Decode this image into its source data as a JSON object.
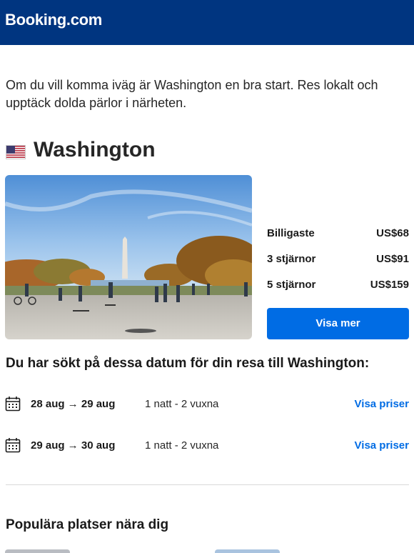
{
  "header": {
    "logo": "Booking.com",
    "bg": "#003580"
  },
  "intro_text": "Om du vill komma iväg är Washington en bra start. Res lokalt och upptäck dolda pärlor i närheten.",
  "destination": {
    "name": "Washington",
    "flag_icon": "us-flag-icon",
    "prices": [
      {
        "label": "Billigaste",
        "value": "US$68"
      },
      {
        "label": "3 stjärnor",
        "value": "US$91"
      },
      {
        "label": "5 stjärnor",
        "value": "US$159"
      }
    ],
    "cta_label": "Visa mer",
    "cta_color": "#006ce4"
  },
  "dates_heading": "Du har sökt på dessa datum för din resa till Washington:",
  "searches": [
    {
      "dates": "28 aug → 29 aug",
      "guests": "1 natt - 2 vuxna",
      "link": "Visa priser",
      "icon": "calendar-icon"
    },
    {
      "dates": "29 aug → 30 aug",
      "guests": "1 natt - 2 vuxna",
      "link": "Visa priser",
      "icon": "calendar-icon"
    }
  ],
  "popular_heading": "Populära platser nära dig"
}
